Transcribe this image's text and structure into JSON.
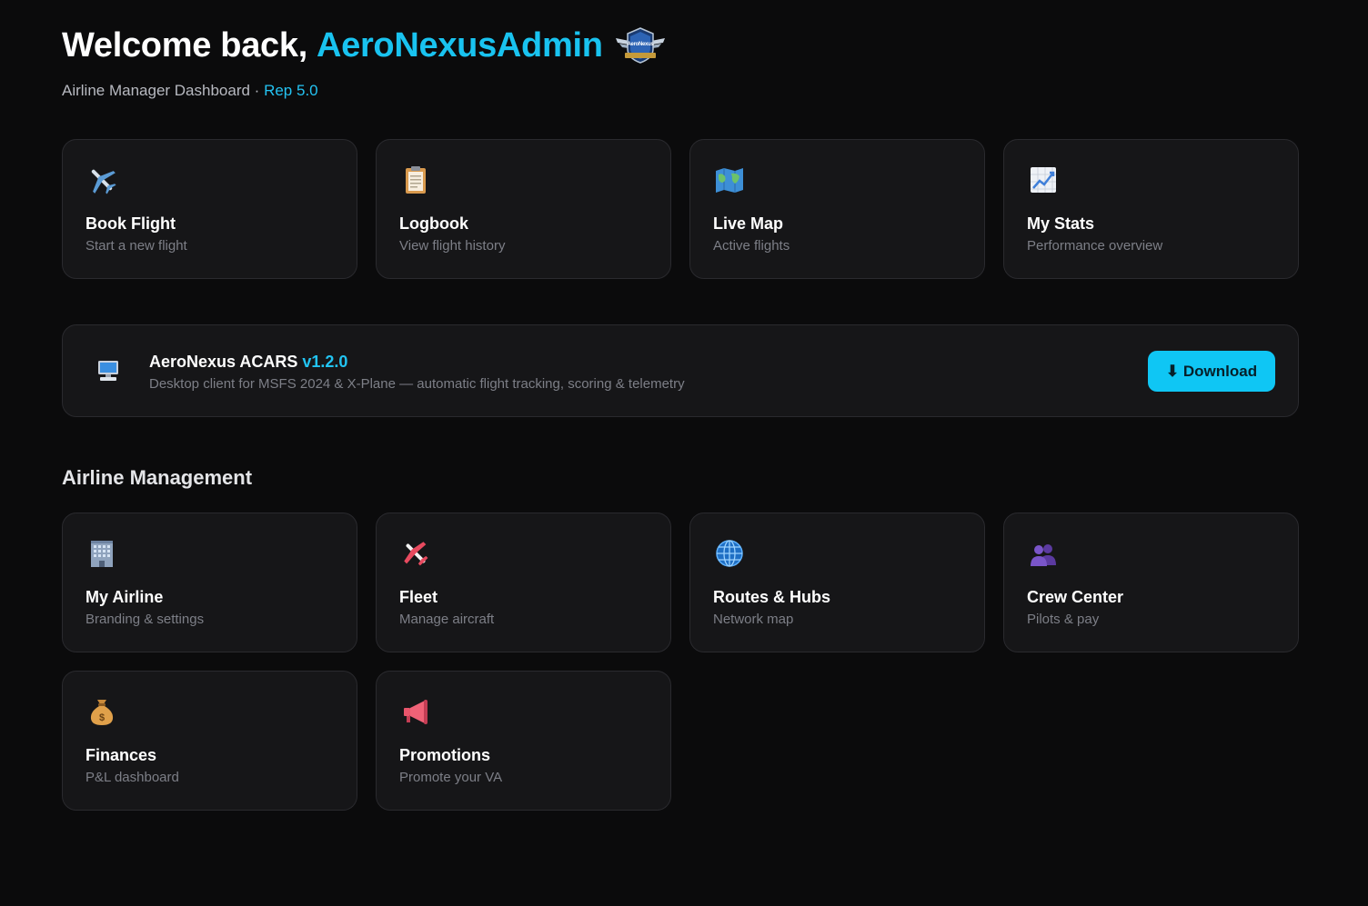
{
  "header": {
    "welcome_prefix": "Welcome back,",
    "username": "AeroNexusAdmin",
    "subtitle_prefix": "Airline Manager Dashboard ·",
    "rep": "Rep 5.0",
    "badge_icon": "aeronexus-wing-badge",
    "badge_text": "AeroNexus"
  },
  "quick_actions": [
    {
      "title": "Book Flight",
      "desc": "Start a new flight",
      "icon": "airplane-icon"
    },
    {
      "title": "Logbook",
      "desc": "View flight history",
      "icon": "clipboard-icon"
    },
    {
      "title": "Live Map",
      "desc": "Active flights",
      "icon": "map-icon"
    },
    {
      "title": "My Stats",
      "desc": "Performance overview",
      "icon": "chart-up-icon"
    }
  ],
  "acars": {
    "name": "AeroNexus ACARS",
    "version": "v1.2.0",
    "desc": "Desktop client for MSFS 2024 & X-Plane — automatic flight tracking, scoring & telemetry",
    "download_label": "⬇ Download",
    "icon": "desktop-computer-icon"
  },
  "management": {
    "title": "Airline Management",
    "items": [
      {
        "title": "My Airline",
        "desc": "Branding & settings",
        "icon": "office-building-icon"
      },
      {
        "title": "Fleet",
        "desc": "Manage aircraft",
        "icon": "small-airplane-icon"
      },
      {
        "title": "Routes & Hubs",
        "desc": "Network map",
        "icon": "globe-icon"
      },
      {
        "title": "Crew Center",
        "desc": "Pilots & pay",
        "icon": "people-icon"
      },
      {
        "title": "Finances",
        "desc": "P&L dashboard",
        "icon": "money-bag-icon"
      },
      {
        "title": "Promotions",
        "desc": "Promote your VA",
        "icon": "megaphone-icon"
      }
    ]
  },
  "colors": {
    "background": "#0b0b0c",
    "card": "#161618",
    "accent": "#19c3f0",
    "muted": "#7d7f87"
  }
}
